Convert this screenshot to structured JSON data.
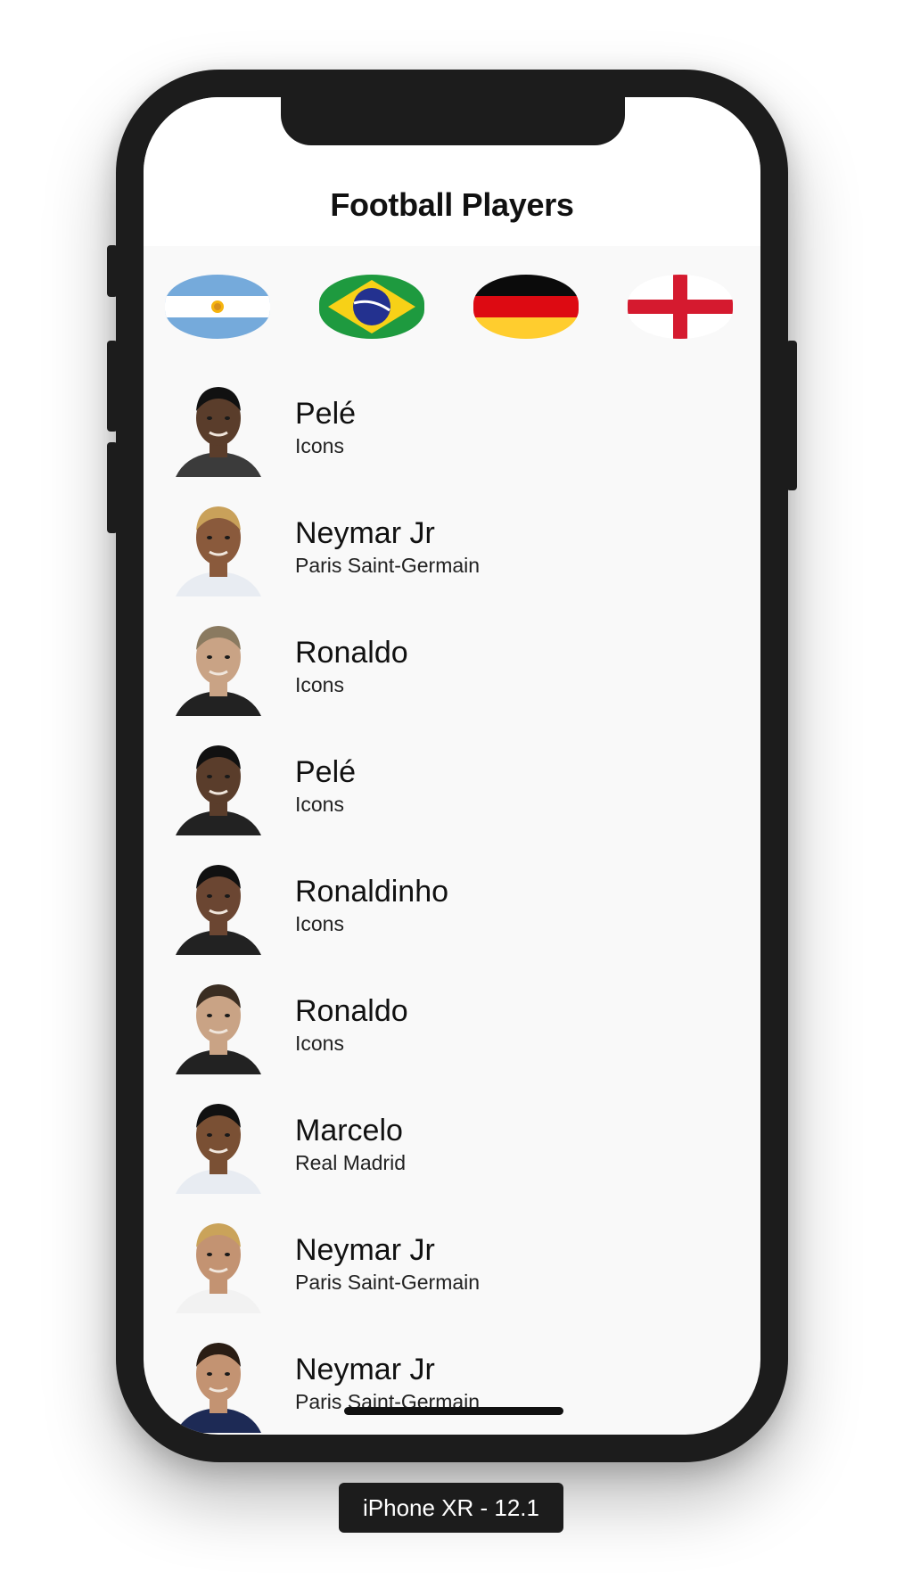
{
  "navbar": {
    "title": "Football Players"
  },
  "flags": [
    {
      "name": "argentina-flag-icon",
      "country": "Argentina"
    },
    {
      "name": "brazil-flag-icon",
      "country": "Brazil"
    },
    {
      "name": "germany-flag-icon",
      "country": "Germany"
    },
    {
      "name": "england-flag-icon",
      "country": "England"
    }
  ],
  "players": [
    {
      "name": "Pelé",
      "club": "Icons"
    },
    {
      "name": "Neymar Jr",
      "club": "Paris Saint-Germain"
    },
    {
      "name": "Ronaldo",
      "club": "Icons"
    },
    {
      "name": "Pelé",
      "club": "Icons"
    },
    {
      "name": "Ronaldinho",
      "club": "Icons"
    },
    {
      "name": "Ronaldo",
      "club": "Icons"
    },
    {
      "name": "Marcelo",
      "club": "Real Madrid"
    },
    {
      "name": "Neymar Jr",
      "club": "Paris Saint-Germain"
    },
    {
      "name": "Neymar Jr",
      "club": "Paris Saint-Germain"
    }
  ],
  "device_label": "iPhone XR - 12.1",
  "colors": {
    "screen_bg": "#f9f9f9",
    "device_frame": "#1c1c1c"
  }
}
